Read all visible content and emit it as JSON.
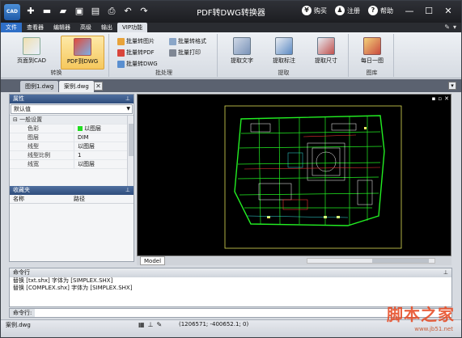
{
  "titlebar": {
    "app_icon": "CAD",
    "title": "PDF转DWG转换器",
    "qat_icons": [
      "new-icon",
      "open-icon",
      "open-folder-icon",
      "save-icon",
      "save-as-icon",
      "print-icon",
      "undo-icon",
      "redo-icon"
    ],
    "actions": [
      {
        "icon": "yen-icon",
        "glyph": "¥",
        "label": "购买"
      },
      {
        "icon": "user-icon",
        "glyph": "♟",
        "label": "注册"
      },
      {
        "icon": "help-icon",
        "glyph": "?",
        "label": "帮助"
      }
    ],
    "window_buttons": [
      "minimize-icon",
      "maximize-icon",
      "close-icon"
    ]
  },
  "menu": {
    "file": "文件",
    "tabs": [
      "查看器",
      "编辑器",
      "高级",
      "输出",
      "VIP功能"
    ],
    "active_tab": "VIP功能"
  },
  "ribbon": {
    "groups": [
      {
        "label": "转换",
        "buttons": [
          {
            "label": "页面到CAD"
          },
          {
            "label": "PDF到DWG",
            "selected": true
          }
        ]
      },
      {
        "label": "批处理",
        "buttons": [
          {
            "label": "批量转图片"
          },
          {
            "label": "批量转格式"
          },
          {
            "label": "批量转PDF"
          },
          {
            "label": "批量打印"
          },
          {
            "label": "批量转DWG"
          }
        ]
      },
      {
        "label": "提取",
        "buttons": [
          {
            "label": "提取文字"
          },
          {
            "label": "提取标注"
          },
          {
            "label": "提取尺寸"
          }
        ]
      },
      {
        "label": "图库",
        "buttons": [
          {
            "label": "每日一图"
          }
        ]
      }
    ]
  },
  "doc_tabs": [
    {
      "label": "图例1.dwg",
      "active": false
    },
    {
      "label": "案例.dwg",
      "active": true
    }
  ],
  "properties": {
    "title": "属性",
    "dropdown": "默认值",
    "category": "一般设置",
    "rows": [
      {
        "key": "色彩",
        "value": "以图层",
        "swatch": "#22dd22"
      },
      {
        "key": "图层",
        "value": "DIM"
      },
      {
        "key": "线型",
        "value": "以图层"
      },
      {
        "key": "线型比例",
        "value": "1"
      },
      {
        "key": "线宽",
        "value": "以图层"
      }
    ]
  },
  "favorites": {
    "title": "收藏夹",
    "columns": [
      "名称",
      "路径"
    ]
  },
  "canvas": {
    "background": "#000000",
    "model_tab": "Model"
  },
  "command": {
    "title": "命令行",
    "lines": [
      "替换 [txt.shx] 字体为 [SIMPLEX.SHX]",
      "替换 [COMPLEX.shx] 字体为 [SIMPLEX.SHX]"
    ],
    "input_label": "命令行:"
  },
  "status": {
    "file": "案例.dwg",
    "coords": "(1206571; -400652.1; 0)"
  },
  "watermark": {
    "text": "脚本之家",
    "url": "www.jb51.net"
  }
}
